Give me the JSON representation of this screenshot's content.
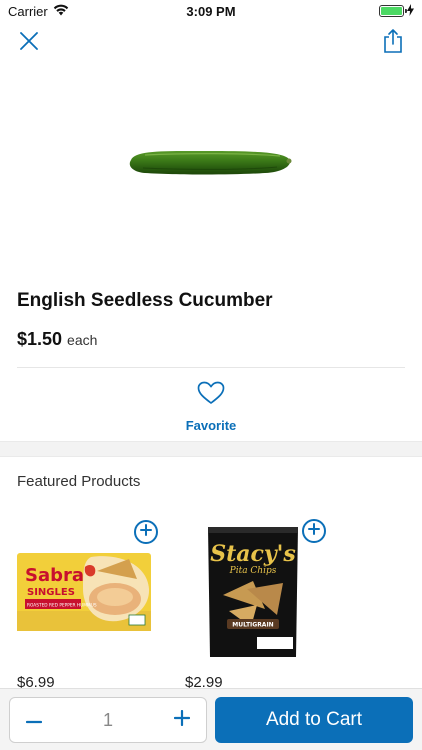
{
  "status_bar": {
    "carrier": "Carrier",
    "time": "3:09 PM",
    "battery_level": 1.0
  },
  "nav": {
    "close_icon": "close-icon",
    "share_icon": "share-icon"
  },
  "product": {
    "title": "English Seedless Cucumber",
    "price": "$1.50",
    "unit": "each",
    "image": "cucumber-image"
  },
  "favorite": {
    "label": "Favorite",
    "icon": "heart-icon"
  },
  "featured": {
    "heading": "Featured Products",
    "items": [
      {
        "image": "sabra-singles-hummus-image",
        "price": "$6.99",
        "brand_text": "Sabra",
        "sub_text": "SINGLES",
        "flavor_text": "ROASTED RED PEPPER HUMMUS"
      },
      {
        "image": "stacys-pita-chips-image",
        "price": "$2.99",
        "brand_text": "Stacy's",
        "sub_text": "Pita Chips",
        "flavor_text": "MULTIGRAIN"
      }
    ]
  },
  "cart": {
    "quantity": "1",
    "add_label": "Add to Cart"
  },
  "colors": {
    "accent": "#0b6fb8",
    "battery": "#4cd964",
    "section_bg": "#f3f3f3"
  }
}
